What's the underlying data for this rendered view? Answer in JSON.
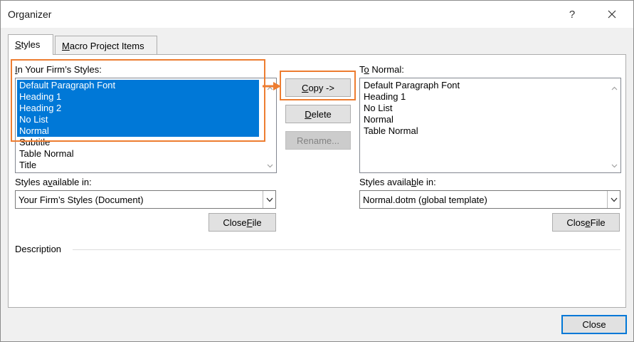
{
  "window": {
    "title": "Organizer",
    "help_glyph": "?"
  },
  "tabs": [
    {
      "pre": "",
      "u": "S",
      "post": "tyles"
    },
    {
      "pre": "",
      "u": "M",
      "post": "acro Project Items"
    }
  ],
  "left": {
    "list_label_u": "I",
    "list_label_rest": "n Your Firm’s Styles:",
    "items": [
      "Default Paragraph Font",
      "Heading 1",
      "Heading 2",
      "No List",
      "Normal",
      "Subtitle",
      "Table Normal",
      "Title"
    ],
    "selected_count": 5,
    "available_label_pre": "Styles a",
    "available_label_u": "v",
    "available_label_post": "ailable in:",
    "available_value": "Your Firm’s Styles (Document)",
    "close_file_pre": "Close ",
    "close_file_u": "F",
    "close_file_post": "ile"
  },
  "right": {
    "list_label_pre": "T",
    "list_label_u": "o",
    "list_label_post": " Normal:",
    "items": [
      "Default Paragraph Font",
      "Heading 1",
      "No List",
      "Normal",
      "Table Normal"
    ],
    "available_label_pre": "Styles availa",
    "available_label_u": "b",
    "available_label_post": "le in:",
    "available_value": "Normal.dotm (global template)",
    "close_file_pre": "Clos",
    "close_file_u": "e",
    "close_file_post": " File"
  },
  "middle": {
    "copy_u": "C",
    "copy_rest": "opy ->",
    "delete_u": "D",
    "delete_rest": "elete",
    "rename_label": "Rename..."
  },
  "description_label": "Description",
  "close_label": "Close",
  "colors": {
    "selection": "#0078d7",
    "highlight": "#ed7d31"
  }
}
